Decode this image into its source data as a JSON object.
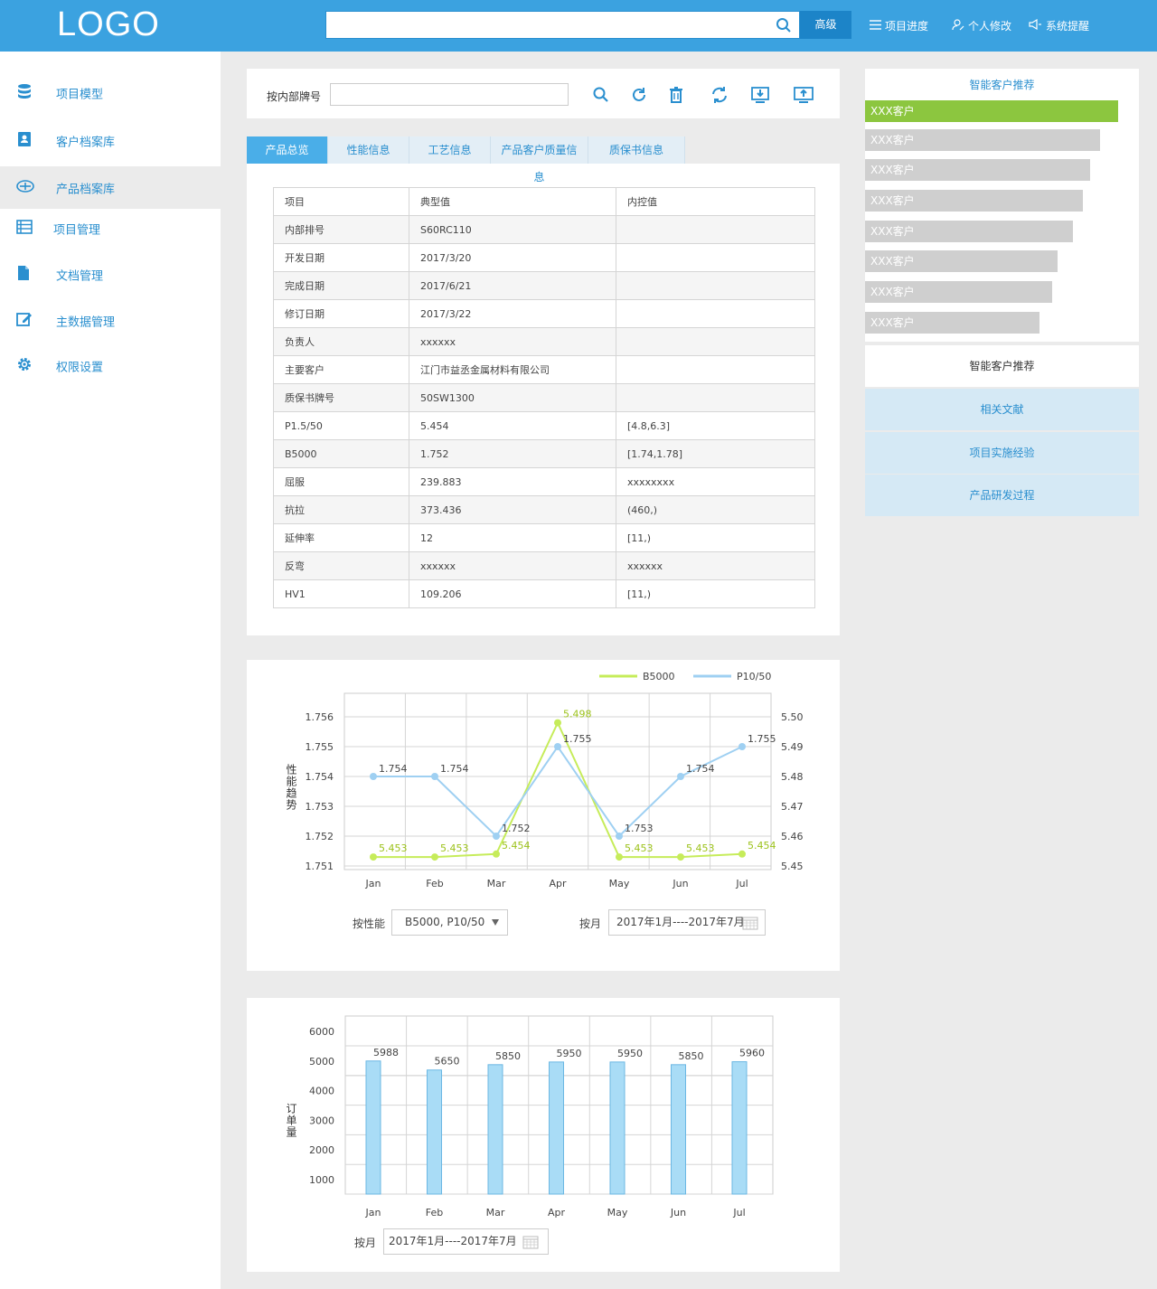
{
  "header": {
    "logo": "LOGO",
    "search_placeholder": "",
    "advanced_label": "高级",
    "nav": [
      {
        "label": "项目进度",
        "icon": "list-icon"
      },
      {
        "label": "个人修改",
        "icon": "user-edit-icon"
      },
      {
        "label": "系统提醒",
        "icon": "megaphone-icon"
      }
    ]
  },
  "sidebar": {
    "items": [
      {
        "label": "项目模型",
        "icon": "database-icon",
        "active": false
      },
      {
        "label": "客户档案库",
        "icon": "contact-book-icon",
        "active": false
      },
      {
        "label": "产品档案库",
        "icon": "archive-icon",
        "active": true
      },
      {
        "label": "项目管理",
        "icon": "list-table-icon",
        "active": false
      },
      {
        "label": "文档管理",
        "icon": "document-icon",
        "active": false
      },
      {
        "label": "主数据管理",
        "icon": "edit-icon",
        "active": false
      },
      {
        "label": "权限设置",
        "icon": "gear-icon",
        "active": false
      }
    ]
  },
  "filter": {
    "label": "按内部牌号",
    "value": "",
    "tools": [
      "search-icon",
      "refresh-icon",
      "delete-icon",
      "sync-icon",
      "download-icon",
      "upload-icon"
    ]
  },
  "tabs": [
    "产品总览",
    "性能信息",
    "工艺信息",
    "产品客户质量信息",
    "质保书信息"
  ],
  "info_table": {
    "headers": [
      "项目",
      "典型值",
      "内控值"
    ],
    "rows": [
      [
        "内部排号",
        "S60RC110",
        ""
      ],
      [
        "开发日期",
        "2017/3/20",
        ""
      ],
      [
        "完成日期",
        "2017/6/21",
        ""
      ],
      [
        "修订日期",
        "2017/3/22",
        ""
      ],
      [
        "负责人",
        "xxxxxx",
        ""
      ],
      [
        "主要客户",
        "江门市益丞金属材料有限公司",
        ""
      ],
      [
        "质保书牌号",
        "50SW1300",
        ""
      ],
      [
        "P1.5/50",
        "5.454",
        "[4.8,6.3]"
      ],
      [
        "B5000",
        "1.752",
        "[1.74,1.78]"
      ],
      [
        "屈服",
        "239.883",
        "xxxxxxxx"
      ],
      [
        "抗拉",
        "373.436",
        "(460,)"
      ],
      [
        "延伸率",
        "12",
        "[11,)"
      ],
      [
        "反弯",
        "xxxxxx",
        "xxxxxx"
      ],
      [
        "HV1",
        "109.206",
        "[11,)"
      ]
    ]
  },
  "recommend": {
    "title": "智能客户推荐",
    "customers": [
      {
        "label": "XXX客户",
        "share": 1.0
      },
      {
        "label": "XXX客户",
        "share": 0.93
      },
      {
        "label": "XXX客户",
        "share": 0.89
      },
      {
        "label": "XXX客户",
        "share": 0.86
      },
      {
        "label": "XXX客户",
        "share": 0.82
      },
      {
        "label": "XXX客户",
        "share": 0.76
      },
      {
        "label": "XXX客户",
        "share": 0.74
      },
      {
        "label": "XXX客户",
        "share": 0.69
      }
    ],
    "section_title": "智能客户推荐",
    "links": [
      "相关文献",
      "项目实施经验",
      "产品研发过程"
    ]
  },
  "chart_data": [
    {
      "type": "line",
      "ylabel": "性能趋势",
      "categories": [
        "Jan",
        "Feb",
        "Mar",
        "Apr",
        "May",
        "Jun",
        "Jul"
      ],
      "ylim_left": [
        1.751,
        1.756
      ],
      "ylim_right": [
        5.45,
        5.5
      ],
      "yticks_left": [
        "1.756",
        "1.755",
        "1.754",
        "1.753",
        "1.752",
        "1.751"
      ],
      "yticks_right": [
        "5.50",
        "5.49",
        "5.48",
        "5.47",
        "5.46",
        "5.45"
      ],
      "legend_position": "top-right",
      "grid": true,
      "series": [
        {
          "name": "B5000",
          "color": "#c6ec5a",
          "axis": "right",
          "values": [
            5.453,
            5.453,
            5.454,
            5.498,
            5.453,
            5.453,
            5.454
          ],
          "labels": [
            "5.453",
            "5.453",
            "5.454",
            "5.498",
            "5.453",
            "5.453",
            "5.454"
          ]
        },
        {
          "name": "P10/50",
          "color": "#9fd0f2",
          "axis": "left",
          "values": [
            1.754,
            1.754,
            1.752,
            1.755,
            1.752,
            1.754,
            1.755
          ],
          "labels": [
            "1.754",
            "1.754",
            "1.752",
            "1.755",
            "1.753",
            "1.754",
            "1.755"
          ]
        }
      ],
      "controls": {
        "metric_label": "按性能",
        "metric_value": "B5000, P10/50",
        "month_label": "按月",
        "month_value": "2017年1月----2017年7月"
      }
    },
    {
      "type": "bar",
      "ylabel": "订单量",
      "categories": [
        "Jan",
        "Feb",
        "Mar",
        "Apr",
        "May",
        "Jun",
        "Jul"
      ],
      "values": [
        5988,
        5650,
        5850,
        5950,
        5950,
        5850,
        5960
      ],
      "ylim": [
        1000,
        6000
      ],
      "yticks": [
        "6000",
        "5000",
        "4000",
        "3000",
        "2000",
        "1000"
      ],
      "grid": true,
      "color": "#a9dcf6",
      "controls": {
        "month_label": "按月",
        "month_value": "2017年1月----2017年7月"
      }
    }
  ]
}
